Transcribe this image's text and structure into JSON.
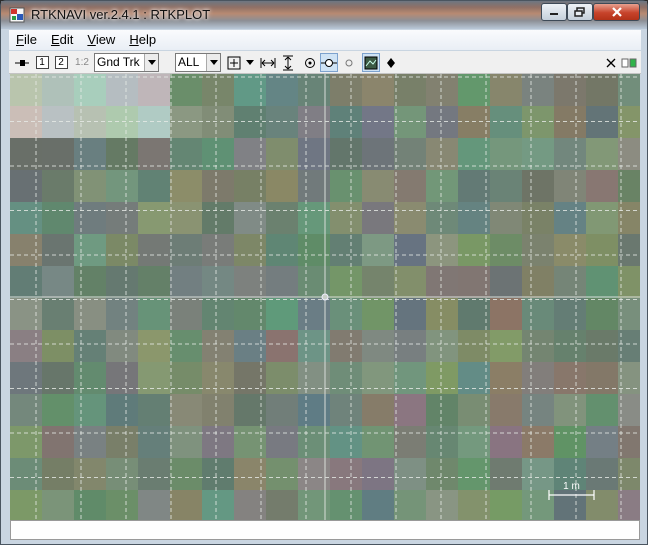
{
  "window": {
    "title": "RTKNAVI ver.2.4.1 : RTKPLOT"
  },
  "menu": [
    {
      "accel": "F",
      "rest": "ile"
    },
    {
      "accel": "E",
      "rest": "dit"
    },
    {
      "accel": "V",
      "rest": "iew"
    },
    {
      "accel": "H",
      "rest": "elp"
    }
  ],
  "toolbar": {
    "solution1": "1",
    "solution2": "2",
    "solution12": "1:2",
    "plot_type": "Gnd Trk",
    "sat_filter": "ALL"
  },
  "icons": {
    "app": "rtknavi-app-icon",
    "connect": "connect-icon",
    "center": "center-origin-icon",
    "range_h": "fit-horizontal-icon",
    "range_v": "fit-vertical-icon",
    "show_track": "show-track-icon",
    "show_point": "show-point-icon",
    "map": "map-image-icon",
    "marker": "marker-icon",
    "close": "close-x-icon",
    "status": "status-indicator-icon"
  },
  "plot": {
    "scale_label": "1 m"
  },
  "colors": {
    "grid_dash": "#e8ece8",
    "axis_line": "#d8ddd8"
  }
}
